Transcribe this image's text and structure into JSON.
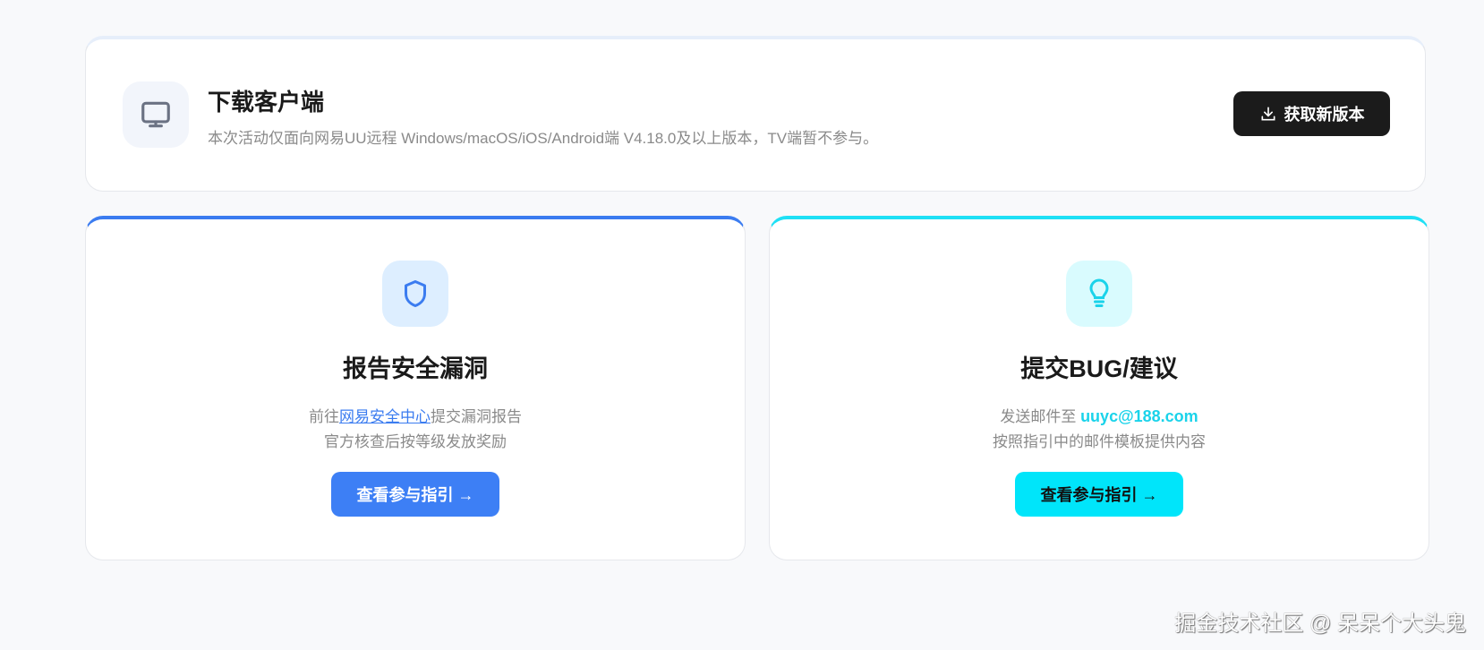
{
  "download": {
    "title": "下载客户端",
    "desc": "本次活动仅面向网易UU远程 Windows/macOS/iOS/Android端 V4.18.0及以上版本，TV端暂不参与。",
    "button": "获取新版本",
    "icon": "monitor-icon"
  },
  "security": {
    "title": "报告安全漏洞",
    "pre": "前往",
    "link": "网易安全中心",
    "post": "提交漏洞报告",
    "line2": "官方核查后按等级发放奖励",
    "button": "查看参与指引 →",
    "icon": "shield-icon",
    "color": "#3b7cf0"
  },
  "bug": {
    "title": "提交BUG/建议",
    "pre": "发送邮件至 ",
    "email": "uuyc@188.com",
    "line2": "按照指引中的邮件模板提供内容",
    "button": "查看参与指引 →",
    "icon": "lightbulb-icon",
    "color": "#00e5fa"
  },
  "watermark": "掘金技术社区 @ 呆呆个大头鬼"
}
